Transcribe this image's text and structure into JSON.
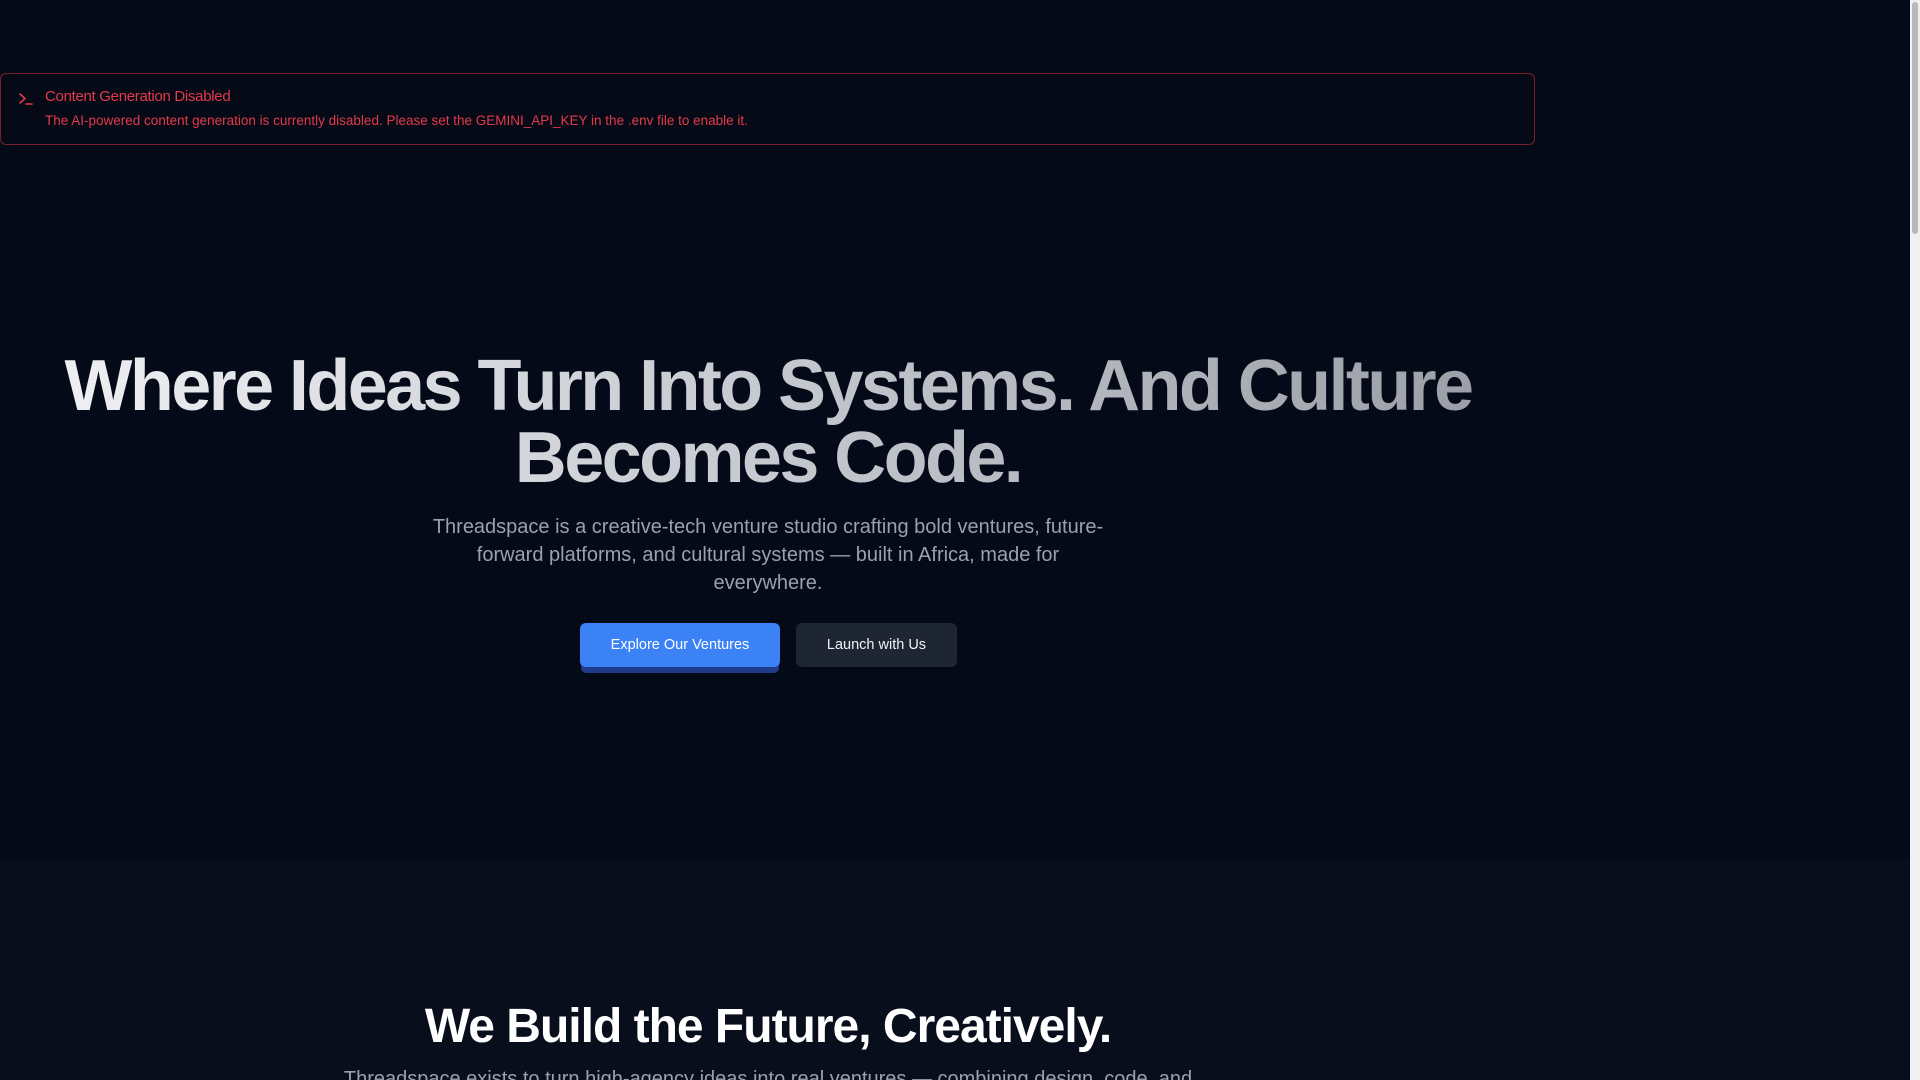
{
  "alert": {
    "icon": "terminal-icon",
    "title": "Content Generation Disabled",
    "description": "The AI-powered content generation is currently disabled. Please set the GEMINI_API_KEY in the .env file to enable it.",
    "color": "#e23a4b"
  },
  "hero": {
    "title": "Where Ideas Turn Into Systems. And Culture Becomes Code.",
    "subtitle": "Threadspace is a creative-tech venture studio crafting bold ventures, future-forward platforms, and cultural systems — built in Africa, made for everywhere.",
    "primary_button": "Explore Our Ventures",
    "secondary_button": "Launch with Us",
    "accent_color": "#3b82f6"
  },
  "about": {
    "title": "We Build the Future, Creatively.",
    "text": "Threadspace exists to turn high-agency ideas into real ventures — combining design, code, and"
  }
}
